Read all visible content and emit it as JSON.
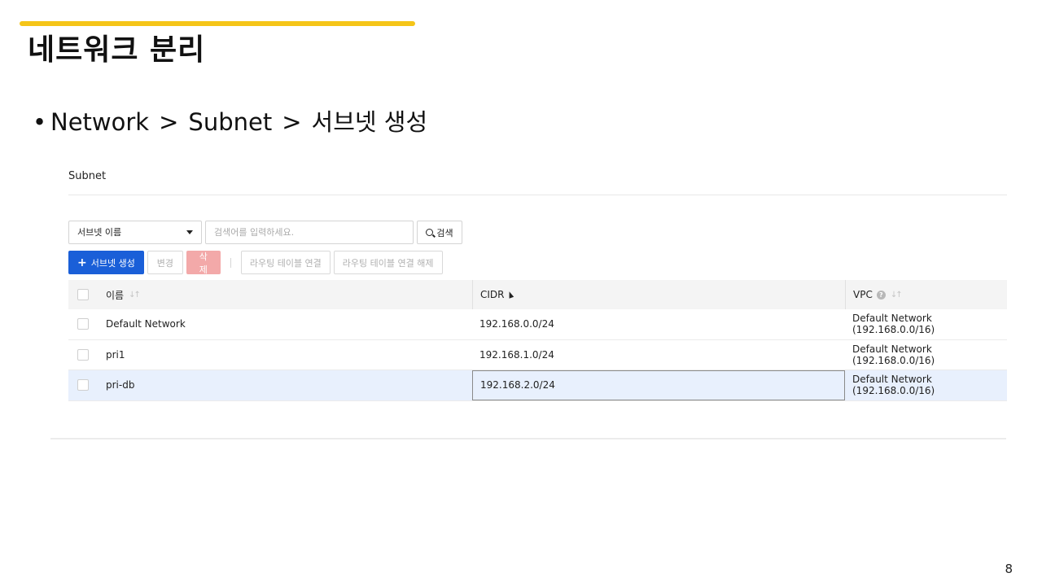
{
  "slide": {
    "title": "네트워크 분리",
    "bullet": {
      "dot": "•",
      "crumbs": [
        "Network",
        "Subnet",
        "서브넷 생성"
      ],
      "separator": ">"
    },
    "page_number": "8"
  },
  "panel": {
    "title": "Subnet",
    "search": {
      "select_value": "서브넷 이름",
      "input_value": "",
      "input_placeholder": "검색어를 입력하세요.",
      "button_label": "검색"
    },
    "actions": {
      "create_label": "서브넷 생성",
      "change_label": "변경",
      "delete_label": "삭제",
      "attach_route_label": "라우팅 테이블 연결",
      "detach_route_label": "라우팅 테이블 연결 해제"
    },
    "table": {
      "headers": {
        "name": "이름",
        "cidr": "CIDR",
        "vpc": "VPC"
      },
      "rows": [
        {
          "name": "Default Network",
          "cidr": "192.168.0.0/24",
          "vpc": "Default Network (192.168.0.0/16)"
        },
        {
          "name": "pri1",
          "cidr": "192.168.1.0/24",
          "vpc": "Default Network (192.168.0.0/16)"
        },
        {
          "name": "pri-db",
          "cidr": "192.168.2.0/24",
          "vpc": "Default Network (192.168.0.0/16)"
        }
      ]
    }
  },
  "colors": {
    "accent_bar": "#f5c518",
    "primary_button": "#1a5fd8",
    "delete_button": "#f3a9a9",
    "selected_row": "#e8f0fd"
  }
}
